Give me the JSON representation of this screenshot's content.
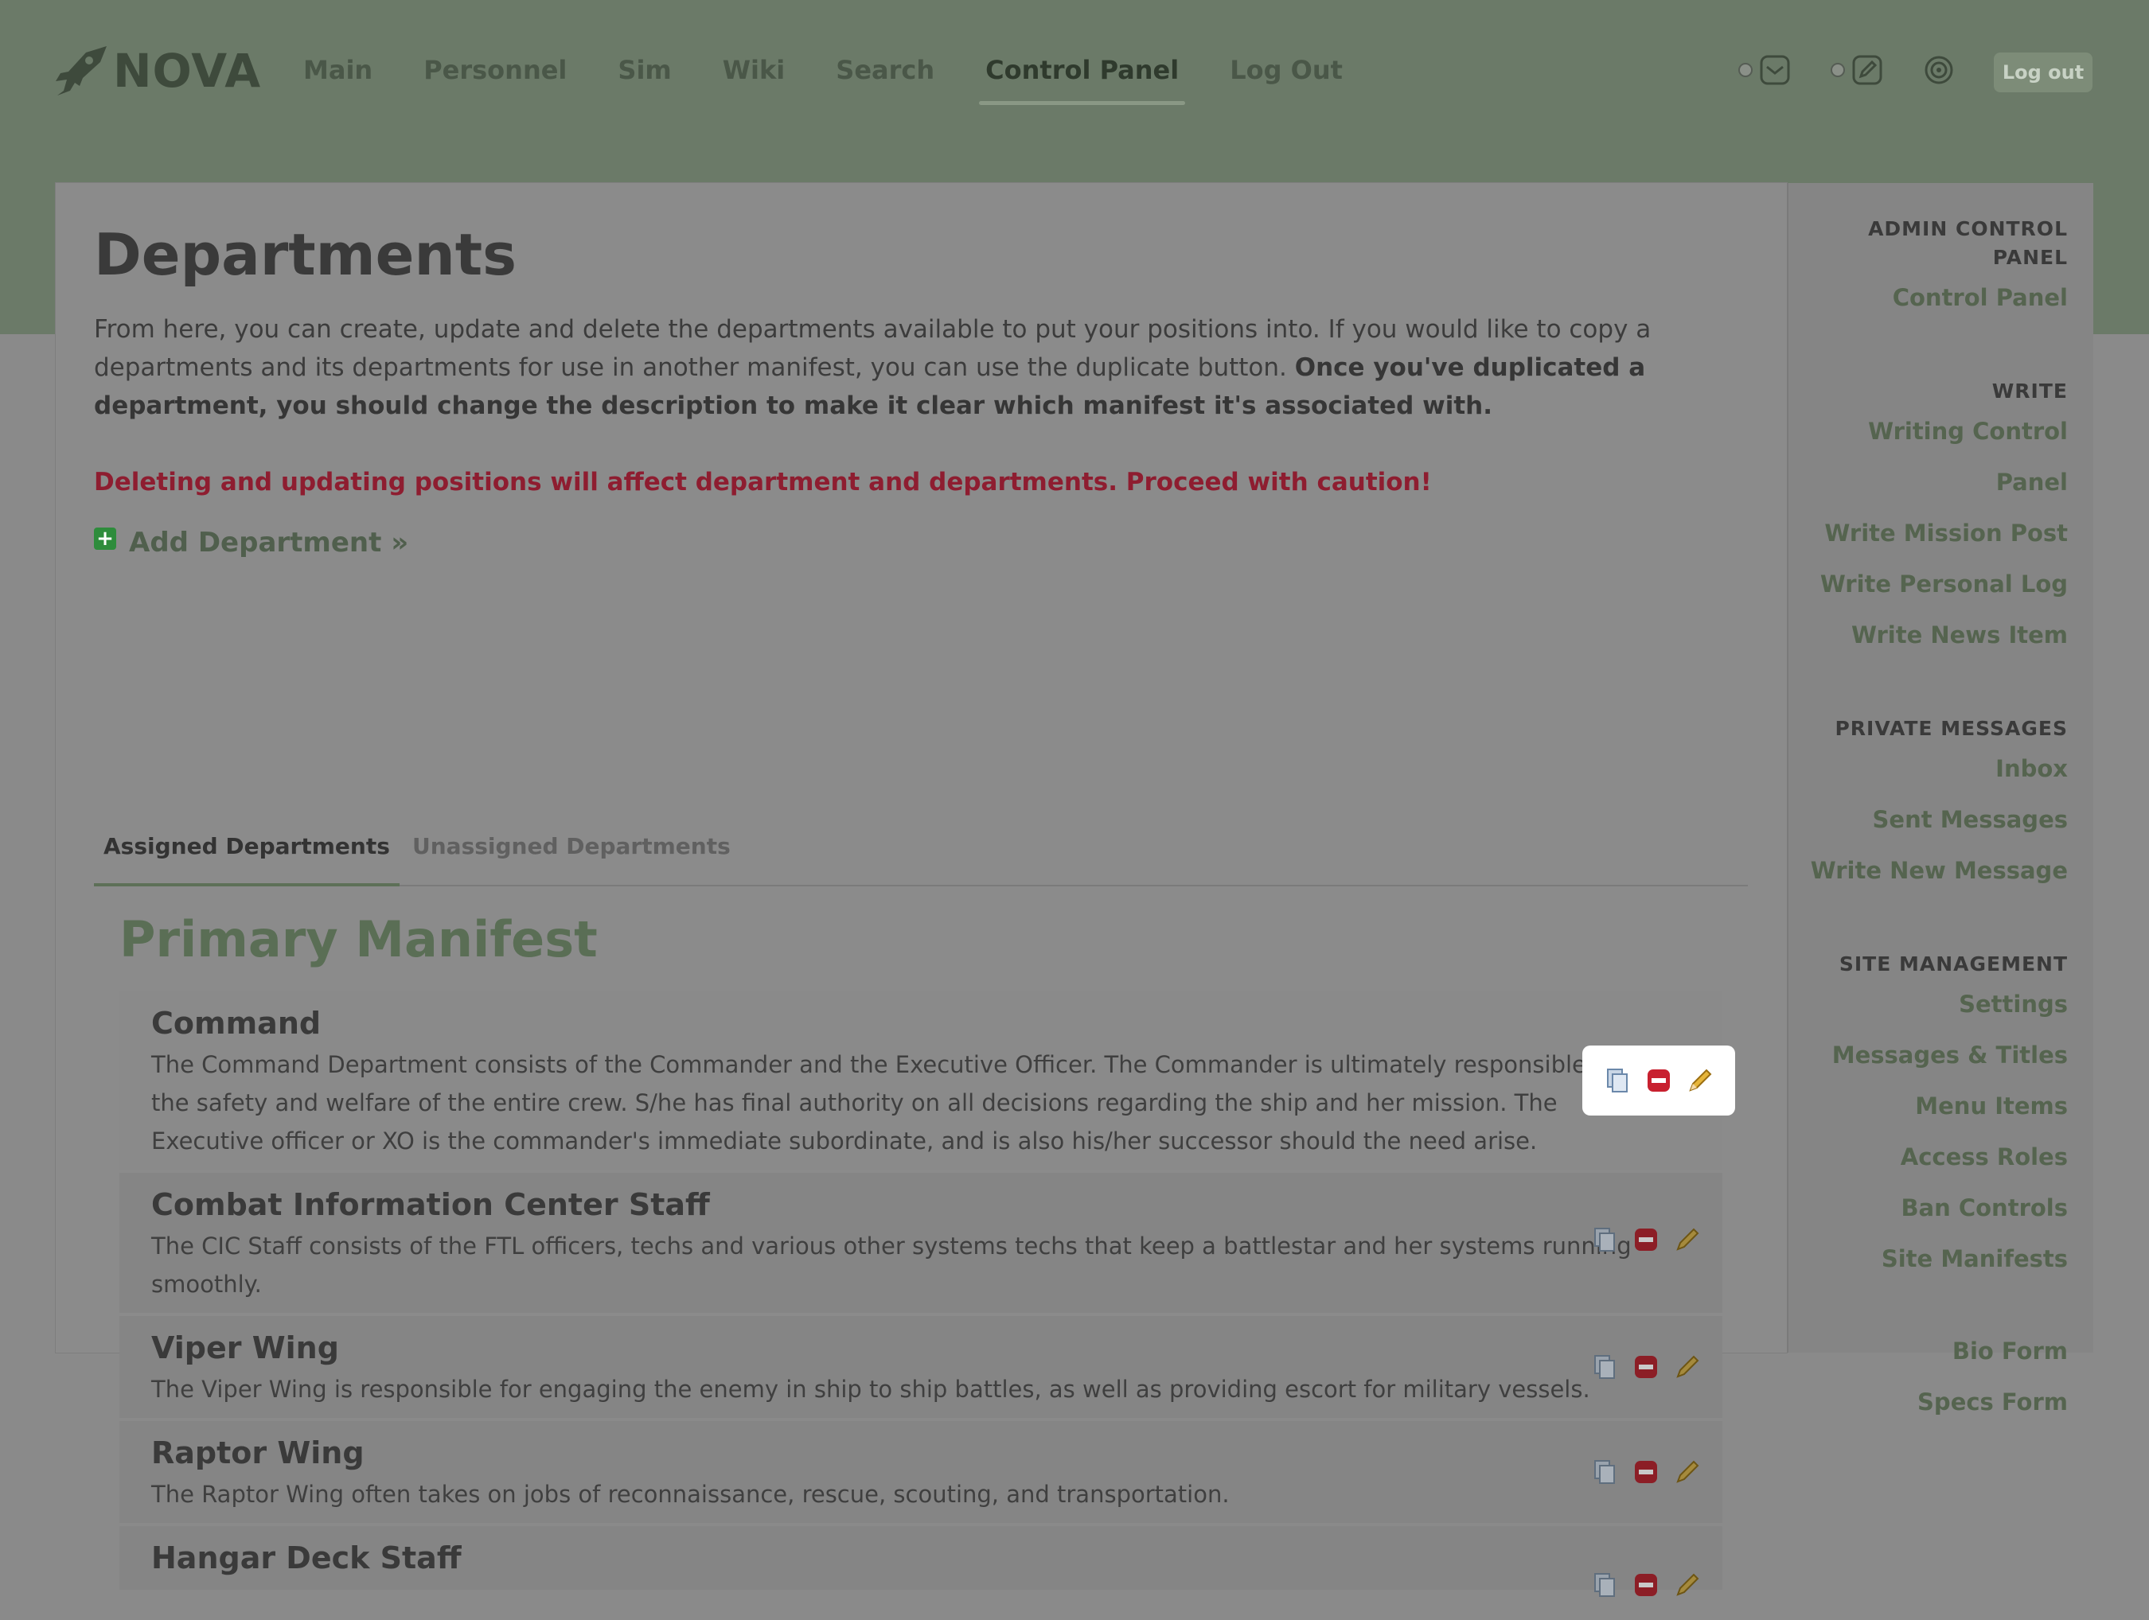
{
  "header": {
    "logo_text": "NOVA",
    "nav": [
      "Main",
      "Personnel",
      "Sim",
      "Wiki",
      "Search",
      "Control Panel",
      "Log Out"
    ],
    "active_nav": "Control Panel",
    "icons": [
      "messages-icon",
      "write-icon",
      "settings-dial-icon"
    ],
    "logout_label": "Log out"
  },
  "page": {
    "title": "Departments",
    "intro_text": "From here, you can create, update and delete the departments available to put your positions into. If you would like to copy a departments and its departments for use in another manifest, you can use the duplicate button. ",
    "intro_bold": "Once you've duplicated a department, you should change the description to make it clear which manifest it's associated with.",
    "warning": "Deleting and updating positions will affect department and departments. Proceed with caution!",
    "add_label": "Add Department »",
    "tabs": [
      "Assigned Departments",
      "Unassigned Departments"
    ],
    "manifest_title": "Primary Manifest",
    "departments": [
      {
        "name": "Command",
        "description": "The Command Department consists of the Commander and the Executive Officer. The Commander is ultimately responsible for the safety and welfare of the entire crew. S/he has final authority on all decisions regarding the ship and her mission. The Executive officer or XO is the commander's immediate subordinate, and is also his/her successor should the need arise."
      },
      {
        "name": "Combat Information Center Staff",
        "description": "The CIC Staff consists of the FTL officers, techs and various other systems techs that keep a battlestar and her systems running smoothly."
      },
      {
        "name": "Viper Wing",
        "description": "The Viper Wing is responsible for engaging the enemy in ship to ship battles, as well as providing escort for military vessels."
      },
      {
        "name": "Raptor Wing",
        "description": "The Raptor Wing often takes on jobs of reconnaissance, rescue, scouting, and transportation."
      },
      {
        "name": "Hangar Deck Staff",
        "description": ""
      }
    ],
    "action_icons": [
      "duplicate-icon",
      "delete-icon",
      "edit-icon"
    ]
  },
  "sidebar": {
    "sections": [
      {
        "heading": "ADMIN CONTROL PANEL",
        "links": [
          "Control Panel"
        ]
      },
      {
        "heading": "WRITE",
        "links": [
          "Writing Control Panel",
          "Write Mission Post",
          "Write Personal Log",
          "Write News Item"
        ]
      },
      {
        "heading": "PRIVATE MESSAGES",
        "links": [
          "Inbox",
          "Sent Messages",
          "Write New Message"
        ]
      },
      {
        "heading": "SITE MANAGEMENT",
        "links": [
          "Settings",
          "Messages & Titles",
          "Menu Items",
          "Access Roles",
          "Ban Controls",
          "Site Manifests"
        ]
      },
      {
        "heading": "",
        "links": [
          "Bio Form",
          "Specs Form"
        ]
      }
    ]
  },
  "colors": {
    "header_bg": "#6b7a68",
    "accent_green": "#5a6e55",
    "warning_red": "#8e1d30",
    "overlay_gray": "#8a8a8a"
  }
}
